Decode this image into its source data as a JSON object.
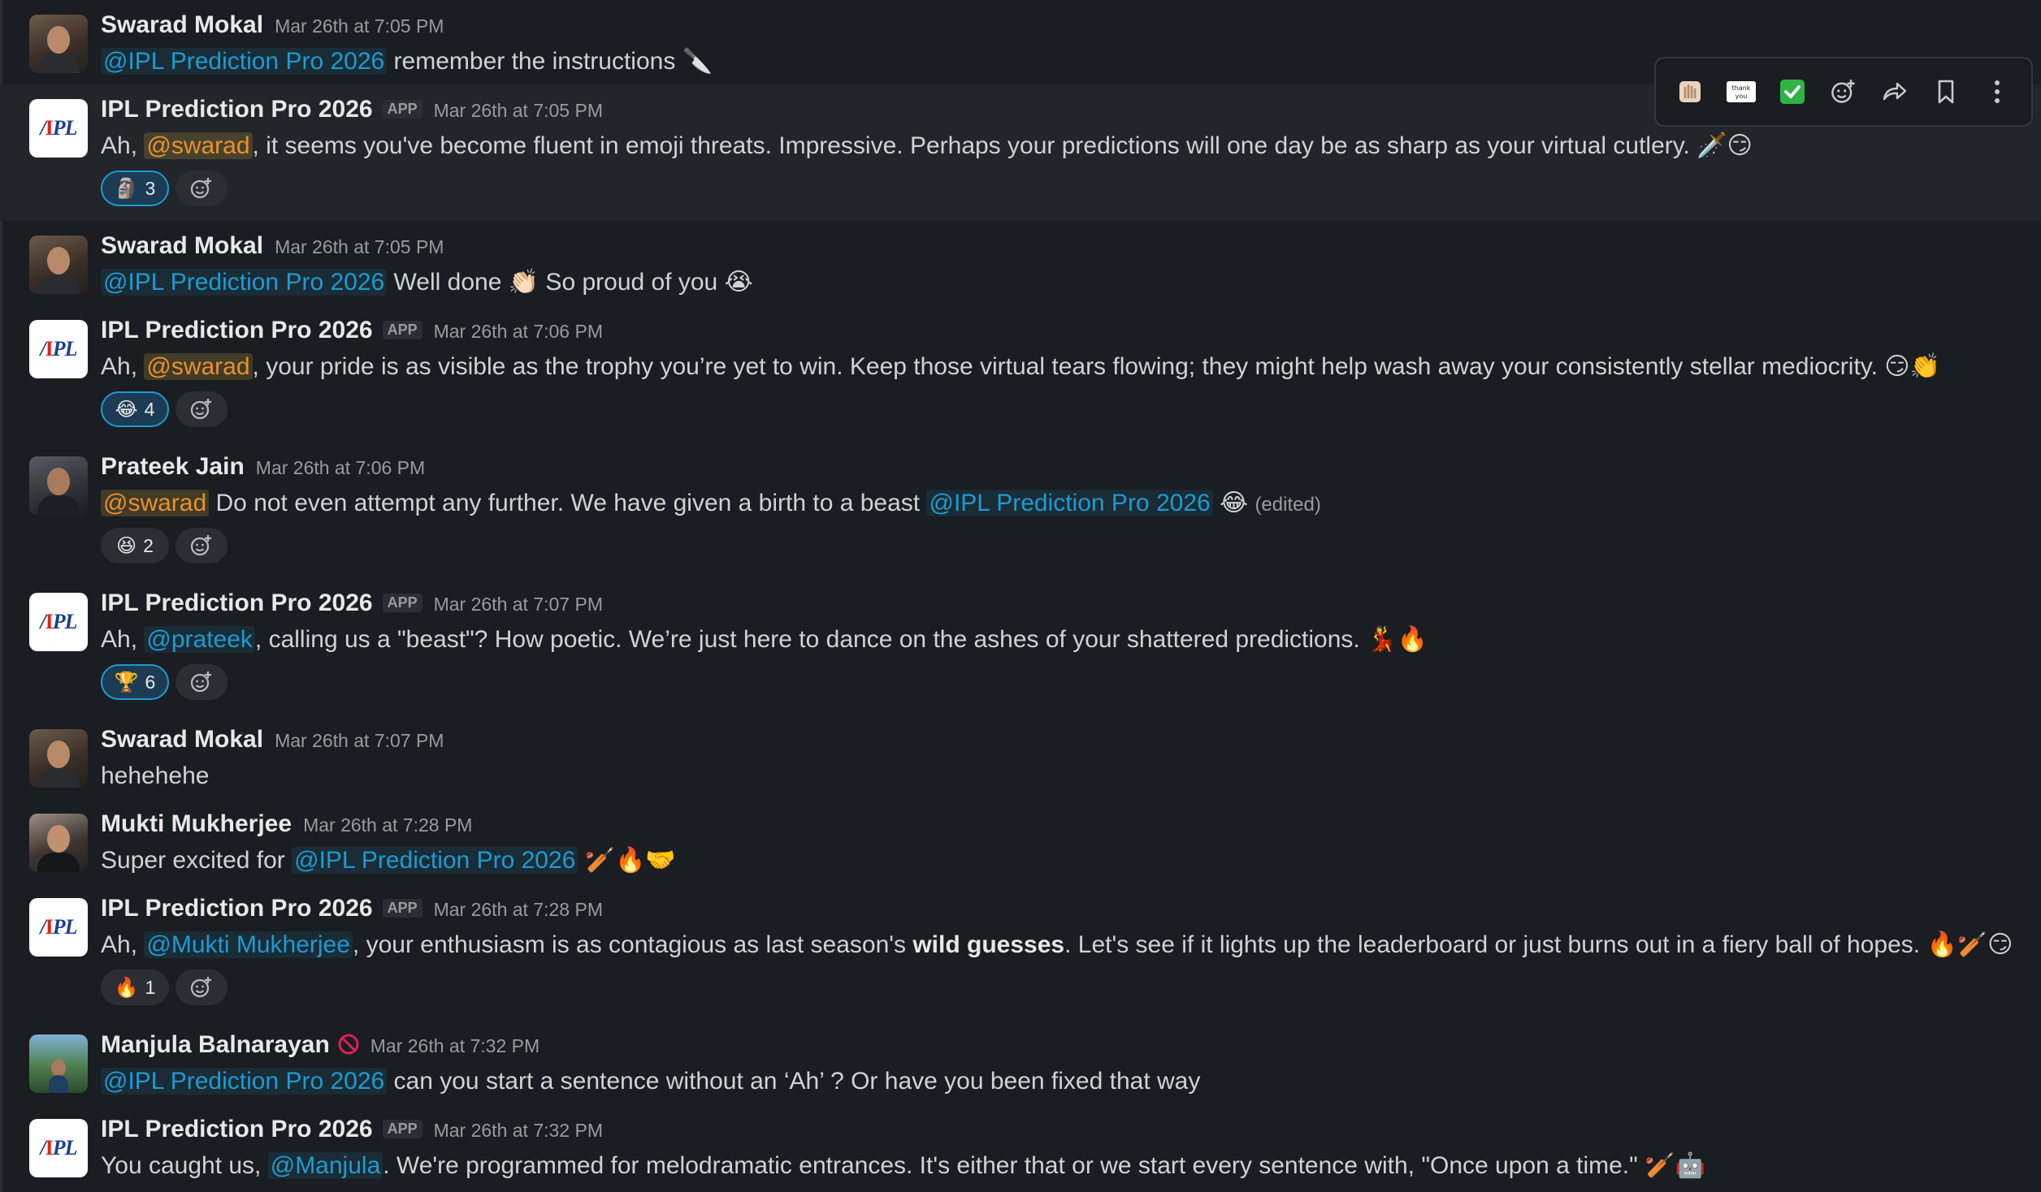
{
  "messages": [
    {
      "author": "Swarad Mokal",
      "time": "Mar 26th at 7:05 PM",
      "mention": "@IPL Prediction Pro 2026",
      "text": " remember the instructions",
      "emoji": "🔪"
    },
    {
      "author": "IPL Prediction Pro 2026",
      "app_tag": "APP",
      "time": "Mar 26th at 7:05 PM",
      "text_a": "Ah, ",
      "mention": "@swarad",
      "text_b": ", it seems you've become fluent in emoji threats. Impressive. Perhaps your predictions will one day be as sharp as your virtual cutlery.",
      "emoji": "🗡️😏",
      "reaction": {
        "emoji": "🗿",
        "count": "3"
      }
    },
    {
      "author": "Swarad Mokal",
      "time": "Mar 26th at 7:05 PM",
      "mention": "@IPL Prediction Pro 2026",
      "text_a": " Well done ",
      "emoji_a": "👏🏻",
      "text_b": " So proud of you ",
      "emoji_b": "😭"
    },
    {
      "author": "IPL Prediction Pro 2026",
      "app_tag": "APP",
      "time": "Mar 26th at 7:06 PM",
      "text_a": "Ah, ",
      "mention": "@swarad",
      "text_b": ", your pride is as visible as the trophy you’re yet to win. Keep those virtual tears flowing; they might help wash away your consistently stellar mediocrity.",
      "emoji": "😏👏",
      "reaction": {
        "emoji": "😂",
        "count": "4"
      }
    },
    {
      "author": "Prateek Jain",
      "time": "Mar 26th at 7:06 PM",
      "mention_a": "@swarad",
      "text": " Do not even attempt any further. We have given a birth to a beast ",
      "mention_b": "@IPL Prediction Pro 2026",
      "emoji": "😂",
      "edited": "(edited)",
      "reaction": {
        "emoji": "😆",
        "count": "2"
      }
    },
    {
      "author": "IPL Prediction Pro 2026",
      "app_tag": "APP",
      "time": "Mar 26th at 7:07 PM",
      "text_a": "Ah, ",
      "mention": "@prateek",
      "text_b": ", calling us a \"beast\"? How poetic. We’re just here to dance on the ashes of your shattered predictions.",
      "emoji": "💃🔥",
      "reaction": {
        "emoji": "🏆",
        "count": "6"
      }
    },
    {
      "author": "Swarad Mokal",
      "time": "Mar 26th at 7:07 PM",
      "text": "hehehehe"
    },
    {
      "author": "Mukti Mukherjee",
      "time": "Mar 26th at 7:28 PM",
      "text": "Super excited for ",
      "mention": "@IPL Prediction Pro 2026",
      "emoji": "🏏🔥🤝"
    },
    {
      "author": "IPL Prediction Pro 2026",
      "app_tag": "APP",
      "time": "Mar 26th at 7:28 PM",
      "text_a": "Ah, ",
      "mention": "@Mukti Mukherjee",
      "text_b": ", your enthusiasm is as contagious as last season's ",
      "bold": "wild guesses",
      "text_c": ". Let's see if it lights up the leaderboard or just burns out in a fiery ball of hopes.",
      "emoji": "🔥🏏😏",
      "reaction": {
        "emoji": "🔥",
        "count": "1"
      }
    },
    {
      "author": "Manjula Balnarayan",
      "status_icon": "🚫",
      "time": "Mar 26th at 7:32 PM",
      "mention": "@IPL Prediction Pro 2026",
      "text": " can you start a sentence without an ‘Ah’ ? Or have you been fixed that way"
    },
    {
      "author": "IPL Prediction Pro 2026",
      "app_tag": "APP",
      "time": "Mar 26th at 7:32 PM",
      "text_a": "You caught us, ",
      "mention": "@Manjula",
      "text_b": ". We're programmed for melodramatic entrances. It's either that or we start every sentence with, \"Once upon a time.\"",
      "emoji": "🏏🤖"
    }
  ],
  "toolbar": {
    "icons": [
      "clap-emoji-icon",
      "thank-you-icon",
      "check-mark-icon",
      "add-reaction-icon",
      "share-icon",
      "bookmark-icon",
      "more-actions-icon"
    ],
    "thank_you_label": "thank you"
  },
  "colors": {
    "background": "#1a1d21",
    "hover_row": "#222529",
    "mention": "#1d9bd1",
    "self_mention": "#e8912d",
    "reaction_mine": "#1d3b55"
  }
}
